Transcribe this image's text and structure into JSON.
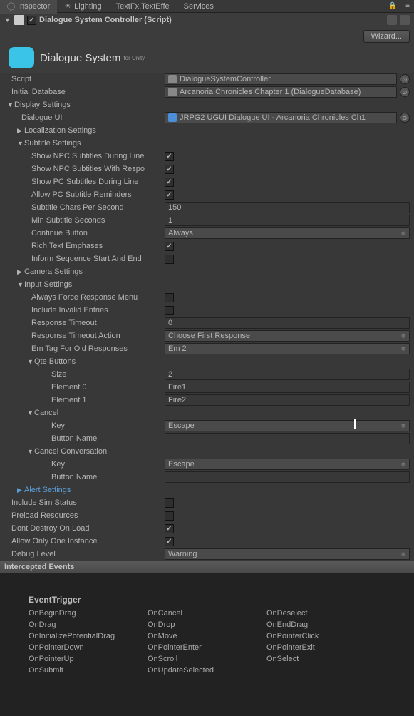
{
  "tabs": {
    "inspector": "Inspector",
    "lighting": "Lighting",
    "textfx": "TextFx.TextEffe",
    "services": "Services"
  },
  "component": {
    "title": "Dialogue System Controller (Script)",
    "logo_main": "Dialogue System",
    "logo_sub": "for Unity",
    "wizard": "Wizard..."
  },
  "fields": {
    "script_label": "Script",
    "script_value": "DialogueSystemController",
    "initdb_label": "Initial Database",
    "initdb_value": "Arcanoria Chronicles Chapter 1 (DialogueDatabase)",
    "display_settings": "Display Settings",
    "dialogue_ui_label": "Dialogue UI",
    "dialogue_ui_value": "JRPG2 UGUI Dialogue UI - Arcanoria Chronicles Ch1",
    "localization": "Localization Settings",
    "subtitle_settings": "Subtitle Settings",
    "show_npc_during": "Show NPC Subtitles During Line",
    "show_npc_respo": "Show NPC Subtitles With Respo",
    "show_pc_during": "Show PC Subtitles During Line",
    "allow_pc_reminders": "Allow PC Subtitle Reminders",
    "chars_per_sec_label": "Subtitle Chars Per Second",
    "chars_per_sec_value": "150",
    "min_subtitle_label": "Min Subtitle Seconds",
    "min_subtitle_value": "1",
    "continue_btn_label": "Continue Button",
    "continue_btn_value": "Always",
    "rich_text": "Rich Text Emphases",
    "inform_seq": "Inform Sequence Start And End",
    "camera_settings": "Camera Settings",
    "input_settings": "Input Settings",
    "always_force": "Always Force Response Menu",
    "include_invalid": "Include Invalid Entries",
    "response_timeout_label": "Response Timeout",
    "response_timeout_value": "0",
    "response_action_label": "Response Timeout Action",
    "response_action_value": "Choose First Response",
    "em_tag_label": "Em Tag For Old Responses",
    "em_tag_value": "Em 2",
    "qte_buttons": "Qte Buttons",
    "size_label": "Size",
    "size_value": "2",
    "elem0_label": "Element 0",
    "elem0_value": "Fire1",
    "elem1_label": "Element 1",
    "elem1_value": "Fire2",
    "cancel": "Cancel",
    "key_label": "Key",
    "cancel_key_value": "Escape",
    "button_name_label": "Button Name",
    "cancel_button_value": "",
    "cancel_conv": "Cancel Conversation",
    "cancel_conv_key": "Escape",
    "cancel_conv_btn": "",
    "alert_settings": "Alert Settings",
    "include_sim": "Include Sim Status",
    "preload": "Preload Resources",
    "dont_destroy": "Dont Destroy On Load",
    "allow_one": "Allow Only One Instance",
    "debug_level_label": "Debug Level",
    "debug_level_value": "Warning"
  },
  "events": {
    "section": "Intercepted Events",
    "title": "EventTrigger",
    "col1": [
      "OnBeginDrag",
      "OnDrag",
      "OnInitializePotentialDrag",
      "OnPointerDown",
      "OnPointerUp",
      "OnSubmit"
    ],
    "col2": [
      "OnCancel",
      "OnDrop",
      "OnMove",
      "OnPointerEnter",
      "OnScroll",
      "OnUpdateSelected"
    ],
    "col3": [
      "OnDeselect",
      "OnEndDrag",
      "OnPointerClick",
      "OnPointerExit",
      "OnSelect"
    ]
  }
}
